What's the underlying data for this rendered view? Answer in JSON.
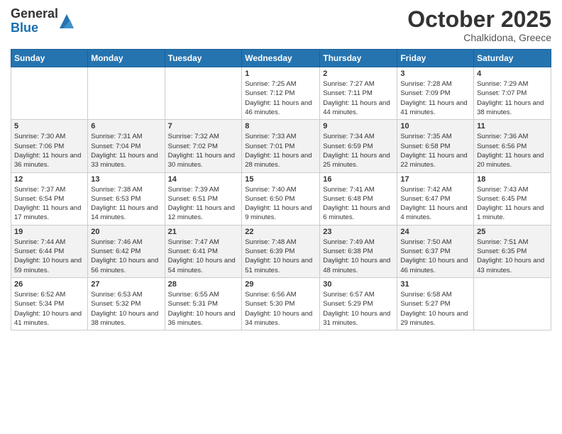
{
  "logo": {
    "general": "General",
    "blue": "Blue"
  },
  "header": {
    "month": "October 2025",
    "location": "Chalkidona, Greece"
  },
  "weekdays": [
    "Sunday",
    "Monday",
    "Tuesday",
    "Wednesday",
    "Thursday",
    "Friday",
    "Saturday"
  ],
  "weeks": [
    [
      {
        "day": "",
        "info": ""
      },
      {
        "day": "",
        "info": ""
      },
      {
        "day": "",
        "info": ""
      },
      {
        "day": "1",
        "info": "Sunrise: 7:25 AM\nSunset: 7:12 PM\nDaylight: 11 hours and 46 minutes."
      },
      {
        "day": "2",
        "info": "Sunrise: 7:27 AM\nSunset: 7:11 PM\nDaylight: 11 hours and 44 minutes."
      },
      {
        "day": "3",
        "info": "Sunrise: 7:28 AM\nSunset: 7:09 PM\nDaylight: 11 hours and 41 minutes."
      },
      {
        "day": "4",
        "info": "Sunrise: 7:29 AM\nSunset: 7:07 PM\nDaylight: 11 hours and 38 minutes."
      }
    ],
    [
      {
        "day": "5",
        "info": "Sunrise: 7:30 AM\nSunset: 7:06 PM\nDaylight: 11 hours and 36 minutes."
      },
      {
        "day": "6",
        "info": "Sunrise: 7:31 AM\nSunset: 7:04 PM\nDaylight: 11 hours and 33 minutes."
      },
      {
        "day": "7",
        "info": "Sunrise: 7:32 AM\nSunset: 7:02 PM\nDaylight: 11 hours and 30 minutes."
      },
      {
        "day": "8",
        "info": "Sunrise: 7:33 AM\nSunset: 7:01 PM\nDaylight: 11 hours and 28 minutes."
      },
      {
        "day": "9",
        "info": "Sunrise: 7:34 AM\nSunset: 6:59 PM\nDaylight: 11 hours and 25 minutes."
      },
      {
        "day": "10",
        "info": "Sunrise: 7:35 AM\nSunset: 6:58 PM\nDaylight: 11 hours and 22 minutes."
      },
      {
        "day": "11",
        "info": "Sunrise: 7:36 AM\nSunset: 6:56 PM\nDaylight: 11 hours and 20 minutes."
      }
    ],
    [
      {
        "day": "12",
        "info": "Sunrise: 7:37 AM\nSunset: 6:54 PM\nDaylight: 11 hours and 17 minutes."
      },
      {
        "day": "13",
        "info": "Sunrise: 7:38 AM\nSunset: 6:53 PM\nDaylight: 11 hours and 14 minutes."
      },
      {
        "day": "14",
        "info": "Sunrise: 7:39 AM\nSunset: 6:51 PM\nDaylight: 11 hours and 12 minutes."
      },
      {
        "day": "15",
        "info": "Sunrise: 7:40 AM\nSunset: 6:50 PM\nDaylight: 11 hours and 9 minutes."
      },
      {
        "day": "16",
        "info": "Sunrise: 7:41 AM\nSunset: 6:48 PM\nDaylight: 11 hours and 6 minutes."
      },
      {
        "day": "17",
        "info": "Sunrise: 7:42 AM\nSunset: 6:47 PM\nDaylight: 11 hours and 4 minutes."
      },
      {
        "day": "18",
        "info": "Sunrise: 7:43 AM\nSunset: 6:45 PM\nDaylight: 11 hours and 1 minute."
      }
    ],
    [
      {
        "day": "19",
        "info": "Sunrise: 7:44 AM\nSunset: 6:44 PM\nDaylight: 10 hours and 59 minutes."
      },
      {
        "day": "20",
        "info": "Sunrise: 7:46 AM\nSunset: 6:42 PM\nDaylight: 10 hours and 56 minutes."
      },
      {
        "day": "21",
        "info": "Sunrise: 7:47 AM\nSunset: 6:41 PM\nDaylight: 10 hours and 54 minutes."
      },
      {
        "day": "22",
        "info": "Sunrise: 7:48 AM\nSunset: 6:39 PM\nDaylight: 10 hours and 51 minutes."
      },
      {
        "day": "23",
        "info": "Sunrise: 7:49 AM\nSunset: 6:38 PM\nDaylight: 10 hours and 48 minutes."
      },
      {
        "day": "24",
        "info": "Sunrise: 7:50 AM\nSunset: 6:37 PM\nDaylight: 10 hours and 46 minutes."
      },
      {
        "day": "25",
        "info": "Sunrise: 7:51 AM\nSunset: 6:35 PM\nDaylight: 10 hours and 43 minutes."
      }
    ],
    [
      {
        "day": "26",
        "info": "Sunrise: 6:52 AM\nSunset: 5:34 PM\nDaylight: 10 hours and 41 minutes."
      },
      {
        "day": "27",
        "info": "Sunrise: 6:53 AM\nSunset: 5:32 PM\nDaylight: 10 hours and 38 minutes."
      },
      {
        "day": "28",
        "info": "Sunrise: 6:55 AM\nSunset: 5:31 PM\nDaylight: 10 hours and 36 minutes."
      },
      {
        "day": "29",
        "info": "Sunrise: 6:56 AM\nSunset: 5:30 PM\nDaylight: 10 hours and 34 minutes."
      },
      {
        "day": "30",
        "info": "Sunrise: 6:57 AM\nSunset: 5:29 PM\nDaylight: 10 hours and 31 minutes."
      },
      {
        "day": "31",
        "info": "Sunrise: 6:58 AM\nSunset: 5:27 PM\nDaylight: 10 hours and 29 minutes."
      },
      {
        "day": "",
        "info": ""
      }
    ]
  ]
}
